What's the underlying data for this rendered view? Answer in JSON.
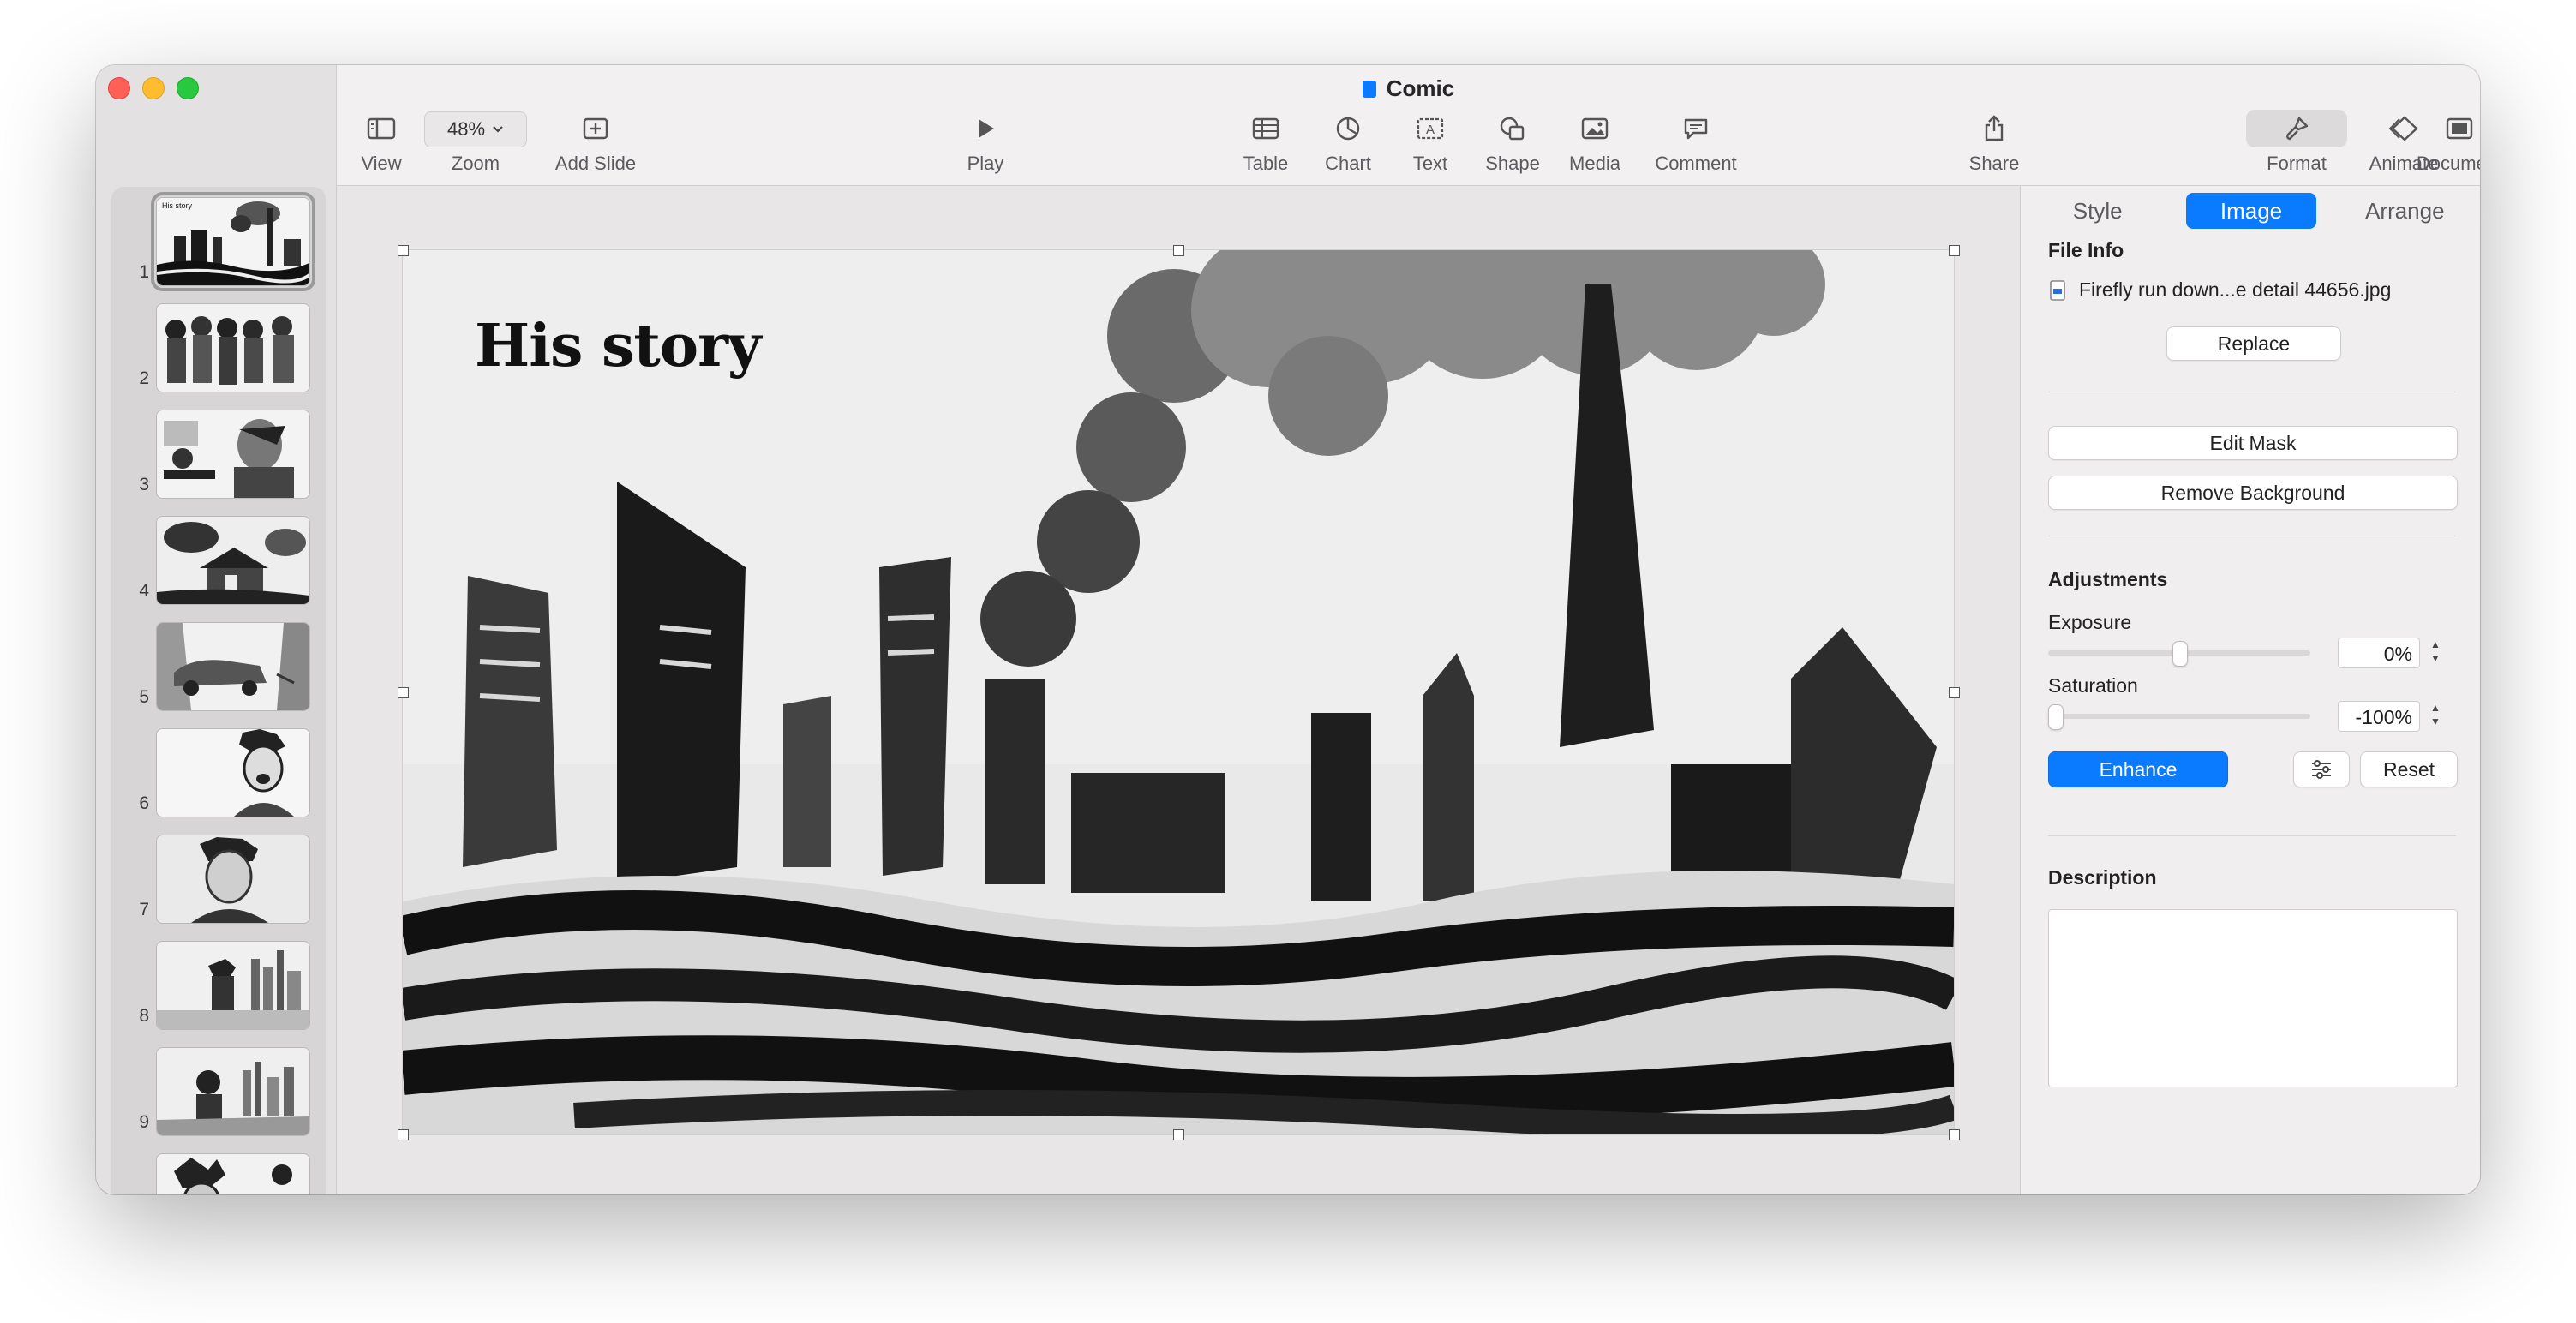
{
  "window": {
    "title": "Comic"
  },
  "toolbar": {
    "view": "View",
    "zoom_label": "Zoom",
    "zoom_value": "48%",
    "add_slide": "Add Slide",
    "play": "Play",
    "table": "Table",
    "chart": "Chart",
    "text": "Text",
    "shape": "Shape",
    "media": "Media",
    "comment": "Comment",
    "share": "Share",
    "format": "Format",
    "animate": "Animate",
    "document": "Document"
  },
  "slides": [
    {
      "number": "1",
      "caption": "His story"
    },
    {
      "number": "2",
      "caption": ""
    },
    {
      "number": "3",
      "caption": ""
    },
    {
      "number": "4",
      "caption": ""
    },
    {
      "number": "5",
      "caption": ""
    },
    {
      "number": "6",
      "caption": ""
    },
    {
      "number": "7",
      "caption": ""
    },
    {
      "number": "8",
      "caption": ""
    },
    {
      "number": "9",
      "caption": ""
    },
    {
      "number": "",
      "caption": ""
    }
  ],
  "slide": {
    "title": "His story"
  },
  "inspector": {
    "tabs": [
      "Style",
      "Image",
      "Arrange"
    ],
    "file_info_title": "File Info",
    "file_name": "Firefly run down...e detail 44656.jpg",
    "replace": "Replace",
    "edit_mask": "Edit Mask",
    "remove_background": "Remove Background",
    "adjustments_title": "Adjustments",
    "exposure_label": "Exposure",
    "exposure_value": "0%",
    "saturation_label": "Saturation",
    "saturation_value": "-100%",
    "enhance": "Enhance",
    "reset": "Reset",
    "description_title": "Description"
  },
  "colors": {
    "accent": "#0a7aff",
    "close": "#fe5f57",
    "minimize": "#febc2e",
    "zoom": "#28c840"
  },
  "icons": [
    "sidebar-view-icon",
    "chevron-down-icon",
    "add-slide-icon",
    "play-icon",
    "table-icon",
    "chart-icon",
    "text-icon",
    "shape-icon",
    "media-icon",
    "comment-icon",
    "share-icon",
    "format-brush-icon",
    "animate-icon",
    "document-icon",
    "file-icon",
    "adjust-sliders-icon"
  ]
}
